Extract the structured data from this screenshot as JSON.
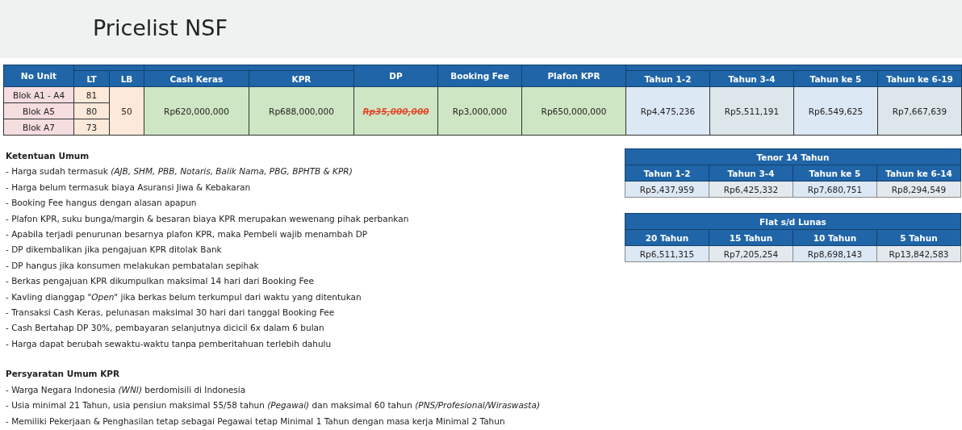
{
  "title": "Pricelist NSF",
  "price_table": {
    "columns": [
      "No Unit",
      "LT",
      "LB",
      "Cash Keras",
      "KPR",
      "DP",
      "Booking Fee",
      "Plafon KPR",
      "Tahun 1-2",
      "Tahun 3-4",
      "Tahun ke 5",
      "Tahun ke 6-19"
    ],
    "units": [
      {
        "name": "Blok A1 - A4",
        "lt": "81"
      },
      {
        "name": "Blok A5",
        "lt": "80"
      },
      {
        "name": "Blok A7",
        "lt": "73"
      }
    ],
    "lb": "50",
    "cash_keras": "Rp620,000,000",
    "kpr": "Rp688,000,000",
    "dp": {
      "text": "Rp35,000,000",
      "struck": true
    },
    "booking_fee": "Rp3,000,000",
    "plafon_kpr": "Rp650,000,000",
    "installments": [
      "Rp4,475,236",
      "Rp5,511,191",
      "Rp6,549,625",
      "Rp7,667,639"
    ]
  },
  "notes": [
    {
      "heading": "Ketentuan Umum",
      "lines": [
        "- Harga sudah termasuk *(AJB, SHM, PBB, Notaris, Balik Nama, PBG, BPHTB & KPR)*",
        "- Harga belum termasuk biaya Asuransi Jiwa & Kebakaran",
        "- Booking Fee hangus dengan alasan apapun",
        "- Plafon KPR, suku bunga/margin & besaran biaya KPR merupakan wewenang pihak perbankan",
        "- Apabila terjadi penurunan besarnya plafon KPR, maka Pembeli wajib menambah DP",
        "- DP dikembalikan jika pengajuan KPR ditolak Bank",
        "- DP hangus jika konsumen melakukan pembatalan sepihak",
        "- Berkas pengajuan KPR dikumpulkan maksimal 14 hari dari Booking Fee",
        "- Kavling dianggap \"*Open*\" jika berkas belum terkumpul dari waktu yang ditentukan",
        "- Transaksi Cash Keras, pelunasan maksimal 30 hari dari tanggal Booking Fee",
        "- Cash Bertahap DP 30%, pembayaran selanjutnya dicicil 6x dalam 6 bulan",
        "- Harga dapat berubah sewaktu-waktu tanpa pemberitahuan terlebih dahulu"
      ]
    },
    {
      "heading": "Persyaratan Umum KPR",
      "lines": [
        "- Warga Negara Indonesia *(WNI)* berdomisili di Indonesia",
        "- Usia minimal 21 Tahun, usia pensiun maksimal 55/58 tahun *(Pegawai)* dan maksimal 60 tahun *(PNS/Profesional/Wiraswasta)*",
        "- Memiliki Pekerjaan & Penghasilan tetap sebagai Pegawai tetap Minimal 1 Tahun dengan masa kerja Minimal 2 Tahun"
      ]
    }
  ],
  "side_tables": [
    {
      "title": "Tenor 14 Tahun",
      "columns": [
        "Tahun 1-2",
        "Tahun 3-4",
        "Tahun ke 5",
        "Tahun ke 6-14"
      ],
      "values": [
        "Rp5,437,959",
        "Rp6,425,332",
        "Rp7,680,751",
        "Rp8,294,549"
      ]
    },
    {
      "title": "Flat s/d Lunas",
      "columns": [
        "20 Tahun",
        "15 Tahun",
        "10 Tahun",
        "5 Tahun"
      ],
      "values": [
        "Rp6,511,315",
        "Rp7,205,254",
        "Rp8,698,143",
        "Rp13,842,583"
      ]
    }
  ]
}
